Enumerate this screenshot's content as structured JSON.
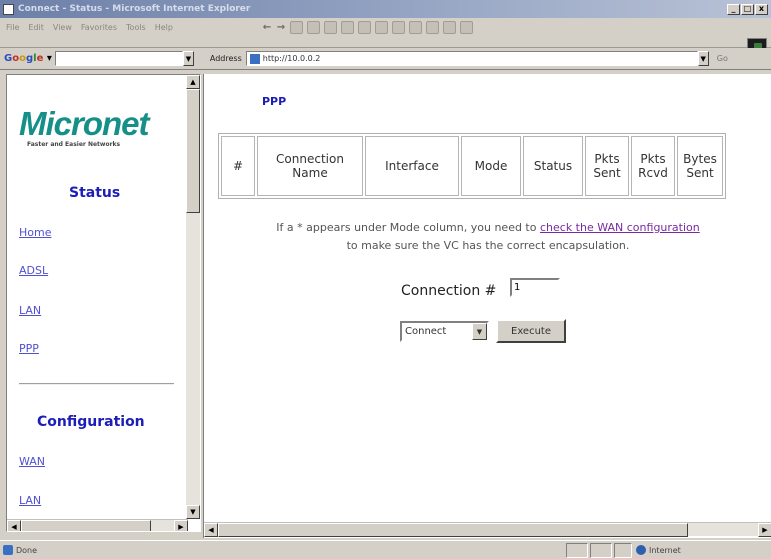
{
  "window": {
    "title": "Connect - Status - Microsoft Internet Explorer",
    "buttons": [
      "_",
      "□",
      "x"
    ]
  },
  "menubar": {
    "items": [
      "File",
      "Edit",
      "View",
      "Favorites",
      "Tools",
      "Help"
    ]
  },
  "googlebar": {
    "logo": "Google",
    "dropdown": "▾"
  },
  "addressbar": {
    "label": "Address",
    "url": "http://10.0.0.2",
    "go": "Go"
  },
  "sidebar": {
    "logo": "Micronet",
    "tagline": "Faster and Easier Networks",
    "status_heading": "Status",
    "status_links": [
      "Home",
      "ADSL",
      "LAN",
      "PPP"
    ],
    "config_heading": "Configuration",
    "config_links": [
      "WAN",
      "LAN"
    ]
  },
  "main": {
    "title": "PPP",
    "table_headers": [
      "#",
      "Connection Name",
      "Interface",
      "Mode",
      "Status",
      "Pkts Sent",
      "Pkts Rcvd",
      "Bytes Sent"
    ],
    "note_before": "If a * appears under Mode column, you need to ",
    "note_link": "check the WAN configuration",
    "note_after": "to make sure the VC has the correct encapsulation.",
    "connection_label": "Connection #",
    "connection_value": "1",
    "action_value": "Connect",
    "execute_label": "Execute"
  },
  "statusbar": {
    "text": "Done",
    "zone": "Internet"
  }
}
